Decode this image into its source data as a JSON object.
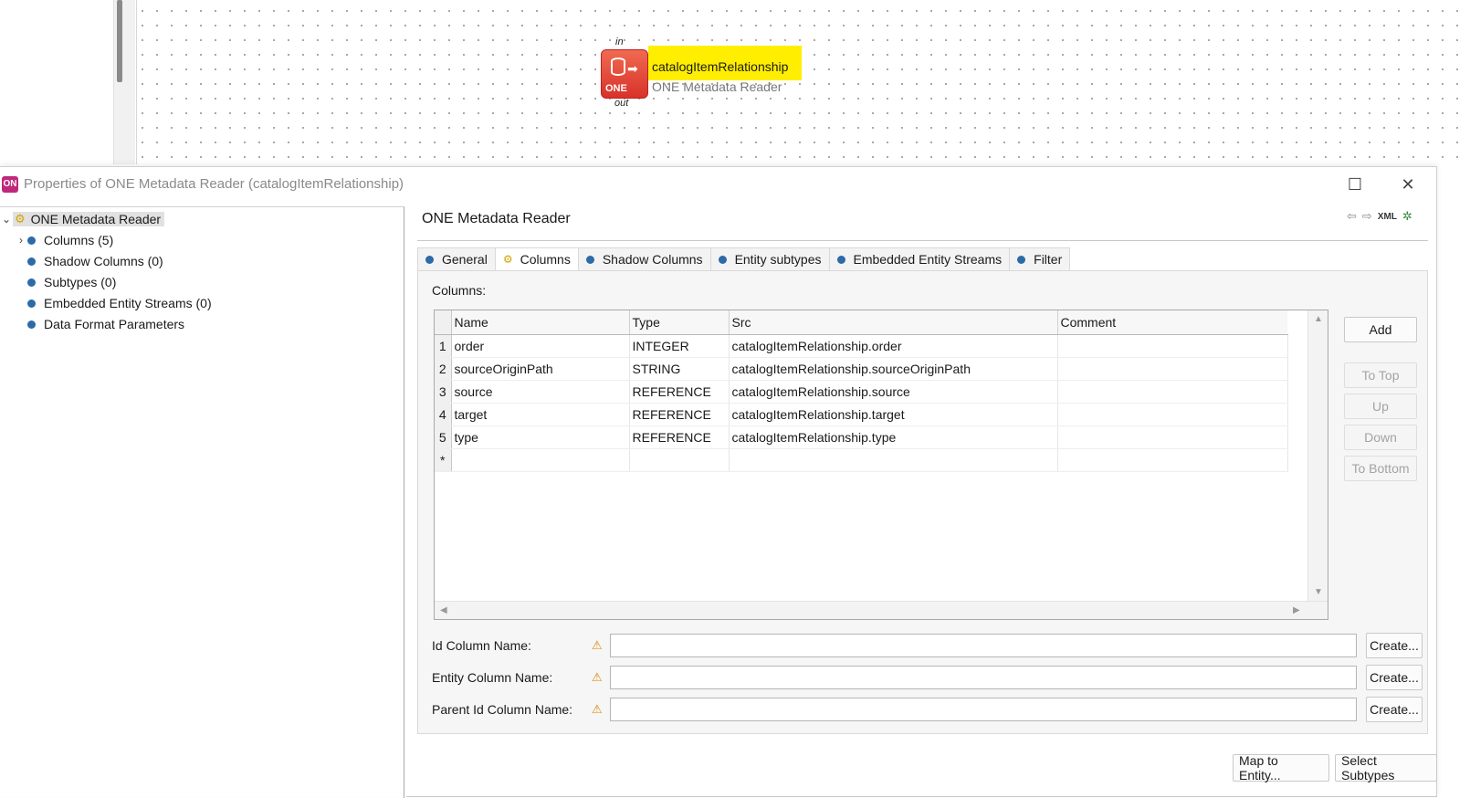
{
  "canvas": {
    "node": {
      "port_in": "in",
      "port_out": "out",
      "logo_text": "ONE",
      "title": "catalogItemRelationship",
      "subtitle": "ONE Metadata Reader"
    }
  },
  "dialog": {
    "title": "Properties of ONE Metadata Reader (catalogItemRelationship)",
    "logo": "ON",
    "maximize_icon": "☐",
    "close_icon": "✕"
  },
  "tree": {
    "root": "ONE Metadata Reader",
    "items": [
      {
        "label": "Columns (5)",
        "expandable": true
      },
      {
        "label": "Shadow Columns (0)"
      },
      {
        "label": "Subtypes (0)"
      },
      {
        "label": "Embedded Entity Streams (0)"
      },
      {
        "label": "Data Format Parameters"
      }
    ]
  },
  "panel": {
    "heading": "ONE Metadata Reader",
    "xml_label": "XML",
    "tabs": [
      {
        "label": "General"
      },
      {
        "label": "Columns",
        "active": true
      },
      {
        "label": "Shadow Columns"
      },
      {
        "label": "Entity subtypes"
      },
      {
        "label": "Embedded Entity Streams"
      },
      {
        "label": "Filter"
      }
    ],
    "columns_label": "Columns:",
    "table": {
      "headers": [
        "Name",
        "Type",
        "Src",
        "Comment"
      ],
      "rows": [
        {
          "n": "1",
          "name": "order",
          "type": "INTEGER",
          "src": "catalogItemRelationship.order",
          "comment": ""
        },
        {
          "n": "2",
          "name": "sourceOriginPath",
          "type": "STRING",
          "src": "catalogItemRelationship.sourceOriginPath",
          "comment": ""
        },
        {
          "n": "3",
          "name": "source",
          "type": "REFERENCE",
          "src": "catalogItemRelationship.source",
          "comment": ""
        },
        {
          "n": "4",
          "name": "target",
          "type": "REFERENCE",
          "src": "catalogItemRelationship.target",
          "comment": ""
        },
        {
          "n": "5",
          "name": "type",
          "type": "REFERENCE",
          "src": "catalogItemRelationship.type",
          "comment": ""
        }
      ],
      "new_row_marker": "*"
    },
    "side_buttons": {
      "add": "Add",
      "to_top": "To Top",
      "up": "Up",
      "down": "Down",
      "to_bottom": "To Bottom"
    },
    "fields": [
      {
        "label": "Id Column Name:",
        "value": "",
        "button": "Create..."
      },
      {
        "label": "Entity Column Name:",
        "value": "",
        "button": "Create..."
      },
      {
        "label": "Parent Id Column Name:",
        "value": "",
        "button": "Create..."
      }
    ]
  },
  "footer": {
    "map_to_entity": "Map to Entity...",
    "select_subtypes": "Select Subtypes"
  },
  "colors": {
    "node_highlight": "#ffee00",
    "node_icon": "#e0402f",
    "tree_dot": "#2c6aa8",
    "warning": "#d48a00"
  }
}
